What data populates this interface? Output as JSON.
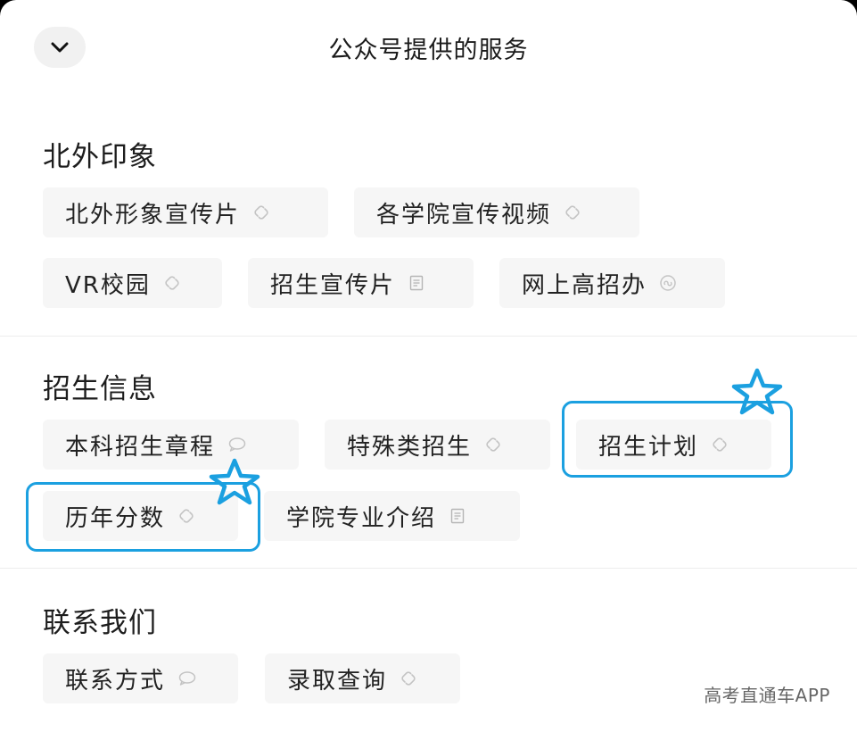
{
  "header": {
    "title": "公众号提供的服务",
    "collapse_icon": "chevron-down-icon"
  },
  "sections": [
    {
      "title": "北外印象",
      "items": [
        {
          "label": "北外形象宣传片",
          "icon": "link-icon"
        },
        {
          "label": "各学院宣传视频",
          "icon": "link-icon"
        },
        {
          "label": "VR校园",
          "icon": "link-icon"
        },
        {
          "label": "招生宣传片",
          "icon": "document-icon"
        },
        {
          "label": "网上高招办",
          "icon": "miniprogram-icon"
        }
      ]
    },
    {
      "title": "招生信息",
      "items": [
        {
          "label": "本科招生章程",
          "icon": "chat-bubble-icon"
        },
        {
          "label": "特殊类招生",
          "icon": "link-icon"
        },
        {
          "label": "招生计划",
          "icon": "link-icon",
          "highlighted": true
        },
        {
          "label": "历年分数",
          "icon": "link-icon",
          "highlighted": true
        },
        {
          "label": "学院专业介绍",
          "icon": "document-icon"
        }
      ]
    },
    {
      "title": "联系我们",
      "items": [
        {
          "label": "联系方式",
          "icon": "chat-bubble-icon"
        },
        {
          "label": "录取查询",
          "icon": "link-icon"
        }
      ]
    }
  ],
  "annotation": {
    "color": "#1ba0e0",
    "mark_icon": "star-outline-icon"
  },
  "watermark": "高考直通车APP"
}
